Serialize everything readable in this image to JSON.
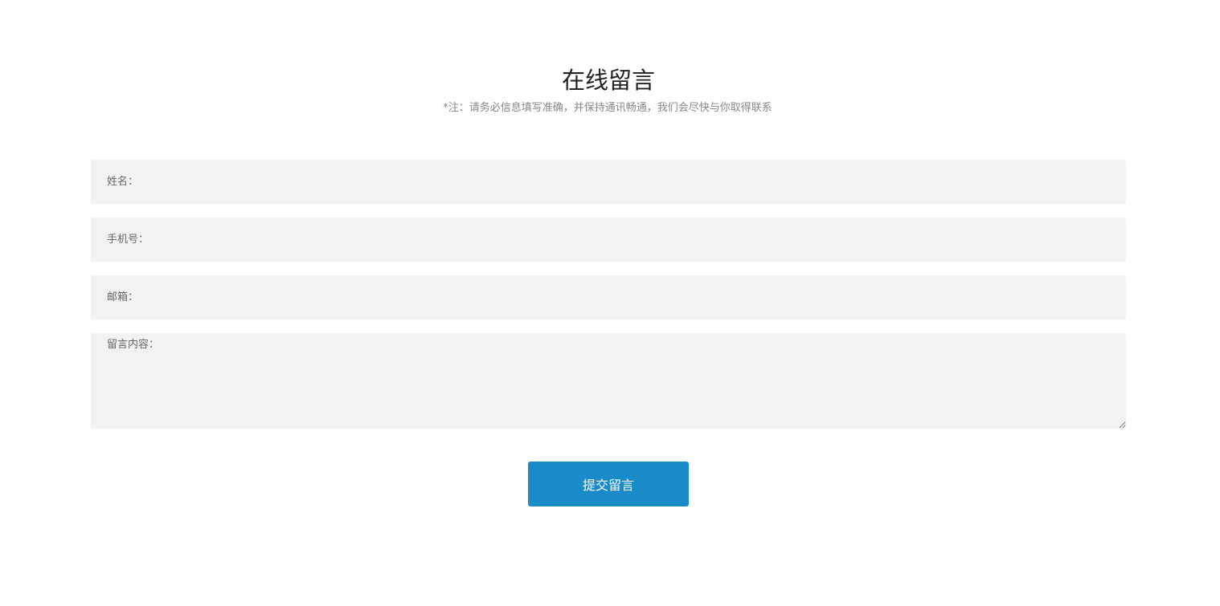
{
  "form": {
    "title": "在线留言",
    "note": "*注：请务必信息填写准确，并保持通讯畅通，我们会尽快与你取得联系",
    "name_placeholder": "姓名：",
    "phone_placeholder": "手机号：",
    "email_placeholder": "邮箱：",
    "message_placeholder": "留言内容：",
    "submit_label": "提交留言"
  },
  "colors": {
    "button_background": "#1a8bc9",
    "field_background": "#f2f2f2"
  }
}
